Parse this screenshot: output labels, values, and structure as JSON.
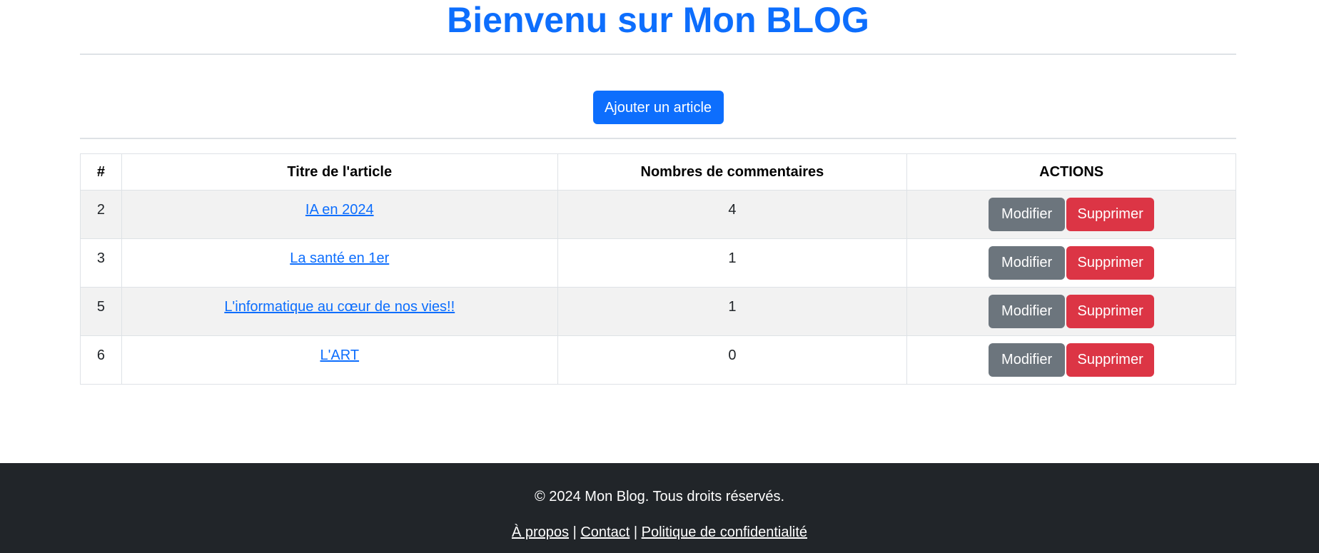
{
  "header": {
    "title": "Bienvenu sur Mon BLOG"
  },
  "toolbar": {
    "add_label": "Ajouter un article"
  },
  "table": {
    "columns": [
      "#",
      "Titre de l'article",
      "Nombres de commentaires",
      "ACTIONS"
    ],
    "rows": [
      {
        "id": "2",
        "title": "IA en 2024",
        "comments": "4"
      },
      {
        "id": "3",
        "title": "La santé en 1er",
        "comments": "1"
      },
      {
        "id": "5",
        "title": "L'informatique au cœur de nos vies!!",
        "comments": "1"
      },
      {
        "id": "6",
        "title": "L'ART",
        "comments": "0"
      }
    ],
    "edit_label": "Modifier",
    "delete_label": "Supprimer"
  },
  "footer": {
    "copyright": "© 2024 Mon Blog. Tous droits réservés.",
    "links": [
      "À propos",
      "Contact",
      "Politique de confidentialité"
    ],
    "separator": "|"
  },
  "colors": {
    "primary": "#0d6efd",
    "secondary": "#6c757d",
    "danger": "#dc3545",
    "footer_bg": "#212529"
  }
}
